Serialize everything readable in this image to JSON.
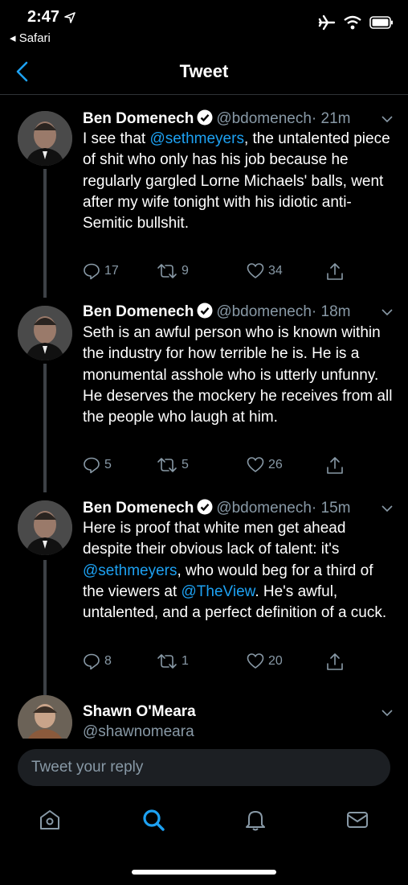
{
  "status": {
    "time": "2:47",
    "back_app": "◂ Safari"
  },
  "nav": {
    "title": "Tweet"
  },
  "tweets": [
    {
      "name": "Ben Domenech",
      "handle": "@bdomenech",
      "time": "· 21m",
      "text_parts": [
        "I see that ",
        "@sethmeyers",
        ", the untalented piece of shit who only has his job because he regularly gargled Lorne Michaels' balls, went after my wife tonight with his idiotic anti-Semitic bullshit."
      ],
      "replies": "17",
      "retweets": "9",
      "likes": "34"
    },
    {
      "name": "Ben Domenech",
      "handle": "@bdomenech",
      "time": "· 18m",
      "text": "Seth is an awful person who is known within the industry for how terrible he is. He is a monumental asshole who is utterly unfunny. He deserves the mockery he receives from all the people who laugh at him.",
      "replies": "5",
      "retweets": "5",
      "likes": "26"
    },
    {
      "name": "Ben Domenech",
      "handle": "@bdomenech",
      "time": "· 15m",
      "text_parts": [
        "Here is proof that white men get ahead despite their obvious lack of talent: it's ",
        "@sethmeyers",
        ", who would beg for a third of the viewers at ",
        "@TheView",
        ". He's awful, untalented, and a perfect definition of a cuck."
      ],
      "replies": "8",
      "retweets": "1",
      "likes": "20"
    },
    {
      "name": "Shawn O'Meara",
      "handle": "@shawnomeara"
    }
  ],
  "reply": {
    "placeholder": "Tweet your reply"
  },
  "tabs": [
    "home-icon",
    "search-icon",
    "notifications-icon",
    "messages-icon"
  ],
  "colors": {
    "accent": "#1da1f2",
    "muted": "#8899a6",
    "background": "#000000"
  }
}
